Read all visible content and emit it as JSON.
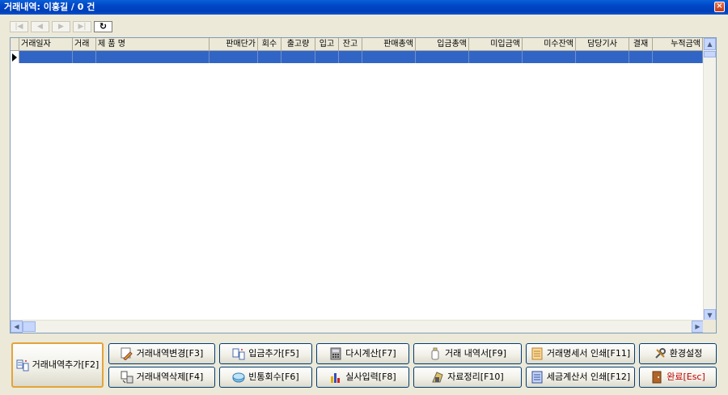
{
  "window": {
    "title": "거래내역: 이홍길 / 0 건",
    "close_label": "×"
  },
  "navigator": {
    "buttons": [
      {
        "name": "first",
        "label": "|◀"
      },
      {
        "name": "prev",
        "label": "◀"
      },
      {
        "name": "next",
        "label": "▶"
      },
      {
        "name": "last",
        "label": "▶|"
      },
      {
        "name": "refresh",
        "label": "↻"
      }
    ]
  },
  "grid": {
    "columns": [
      "거래일자",
      "거래",
      "제   품   명",
      "판매단가",
      "회수",
      "출고량",
      "입고",
      "잔고",
      "판매총액",
      "입금총액",
      "미입금액",
      "미수잔액",
      "담당기사",
      "결재",
      "누적금액"
    ],
    "rows": []
  },
  "buttons": {
    "add_trade": "거래내역추가[F2]",
    "edit_trade": "거래내역변경[F3]",
    "delete_trade": "거래내역삭제[F4]",
    "add_deposit": "입금추가[F5]",
    "bottle_return": "빈통회수[F6]",
    "recalc": "다시계산[F7]",
    "actual_input": "실사입력[F8]",
    "statement": "거래 내역서[F9]",
    "data_cleanup": "자료정리[F10]",
    "print_statement": "거래명세서 인쇄[F11]",
    "print_tax_invoice": "세금계산서 인쇄[F12]",
    "settings": "환경설정",
    "done": "완료[Esc]"
  },
  "colors": {
    "selection": "#3165c5",
    "accent_done": "#c00000"
  }
}
